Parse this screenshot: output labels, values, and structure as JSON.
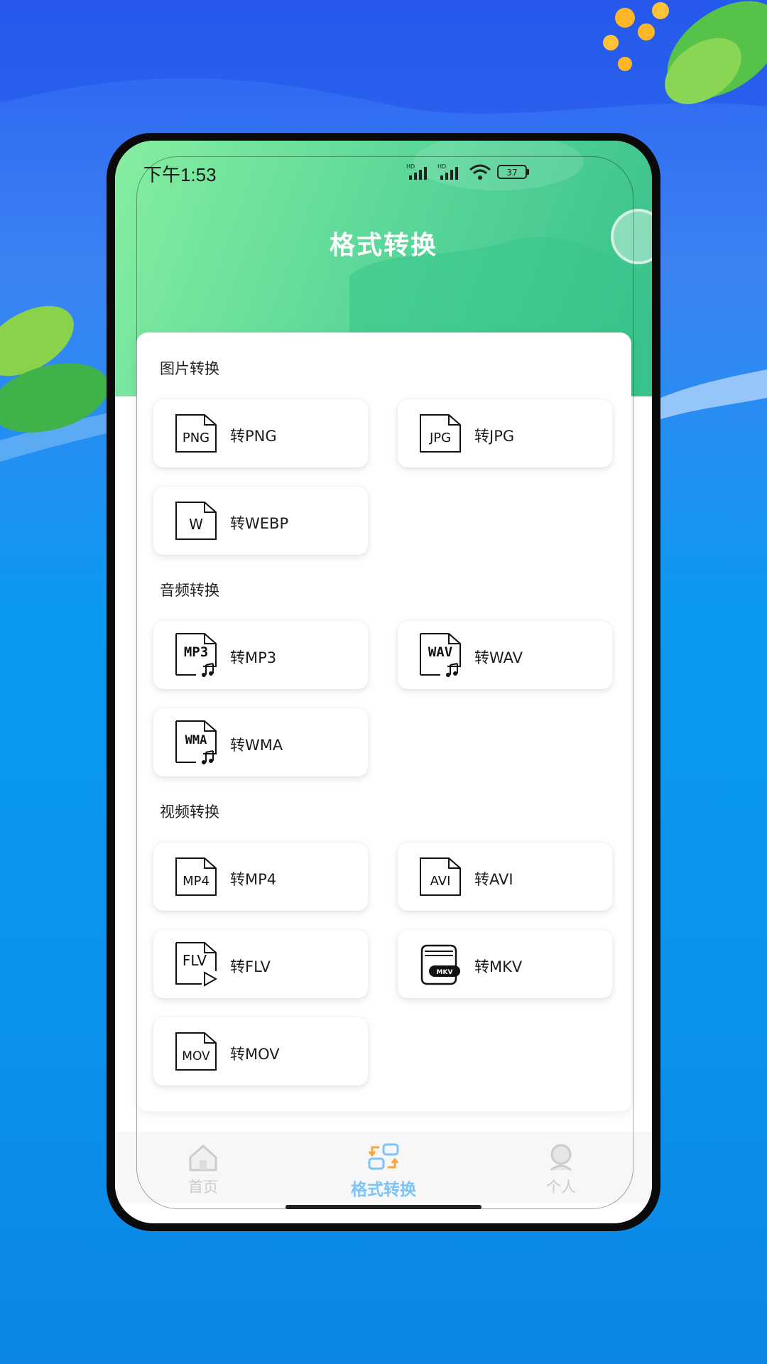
{
  "status_bar": {
    "time": "下午1:53",
    "battery": "37"
  },
  "header": {
    "title": "格式转换"
  },
  "sections": [
    {
      "title": "图片转换",
      "items": [
        {
          "icon_text": "PNG",
          "label": "转PNG"
        },
        {
          "icon_text": "JPG",
          "label": "转JPG"
        },
        {
          "icon_text": "W",
          "label": "转WEBP"
        }
      ]
    },
    {
      "title": "音频转换",
      "items": [
        {
          "icon_text": "MP3",
          "label": "转MP3"
        },
        {
          "icon_text": "WAV",
          "label": "转WAV"
        },
        {
          "icon_text": "WMA",
          "label": "转WMA"
        }
      ]
    },
    {
      "title": "视频转换",
      "items": [
        {
          "icon_text": "MP4",
          "label": "转MP4"
        },
        {
          "icon_text": "AVI",
          "label": "转AVI"
        },
        {
          "icon_text": "FLV",
          "label": "转FLV"
        },
        {
          "icon_text": "MKV",
          "label": "转MKV"
        },
        {
          "icon_text": "MOV",
          "label": "转MOV"
        }
      ]
    }
  ],
  "bottom_nav": [
    {
      "label": "首页",
      "active": false,
      "icon": "home-icon"
    },
    {
      "label": "格式转换",
      "active": true,
      "icon": "convert-icon"
    },
    {
      "label": "个人",
      "active": false,
      "icon": "user-icon"
    }
  ],
  "colors": {
    "header_start": "#86eea0",
    "header_end": "#37c08a",
    "nav_active": "#7cc3f7",
    "nav_inactive": "#cccccc"
  }
}
